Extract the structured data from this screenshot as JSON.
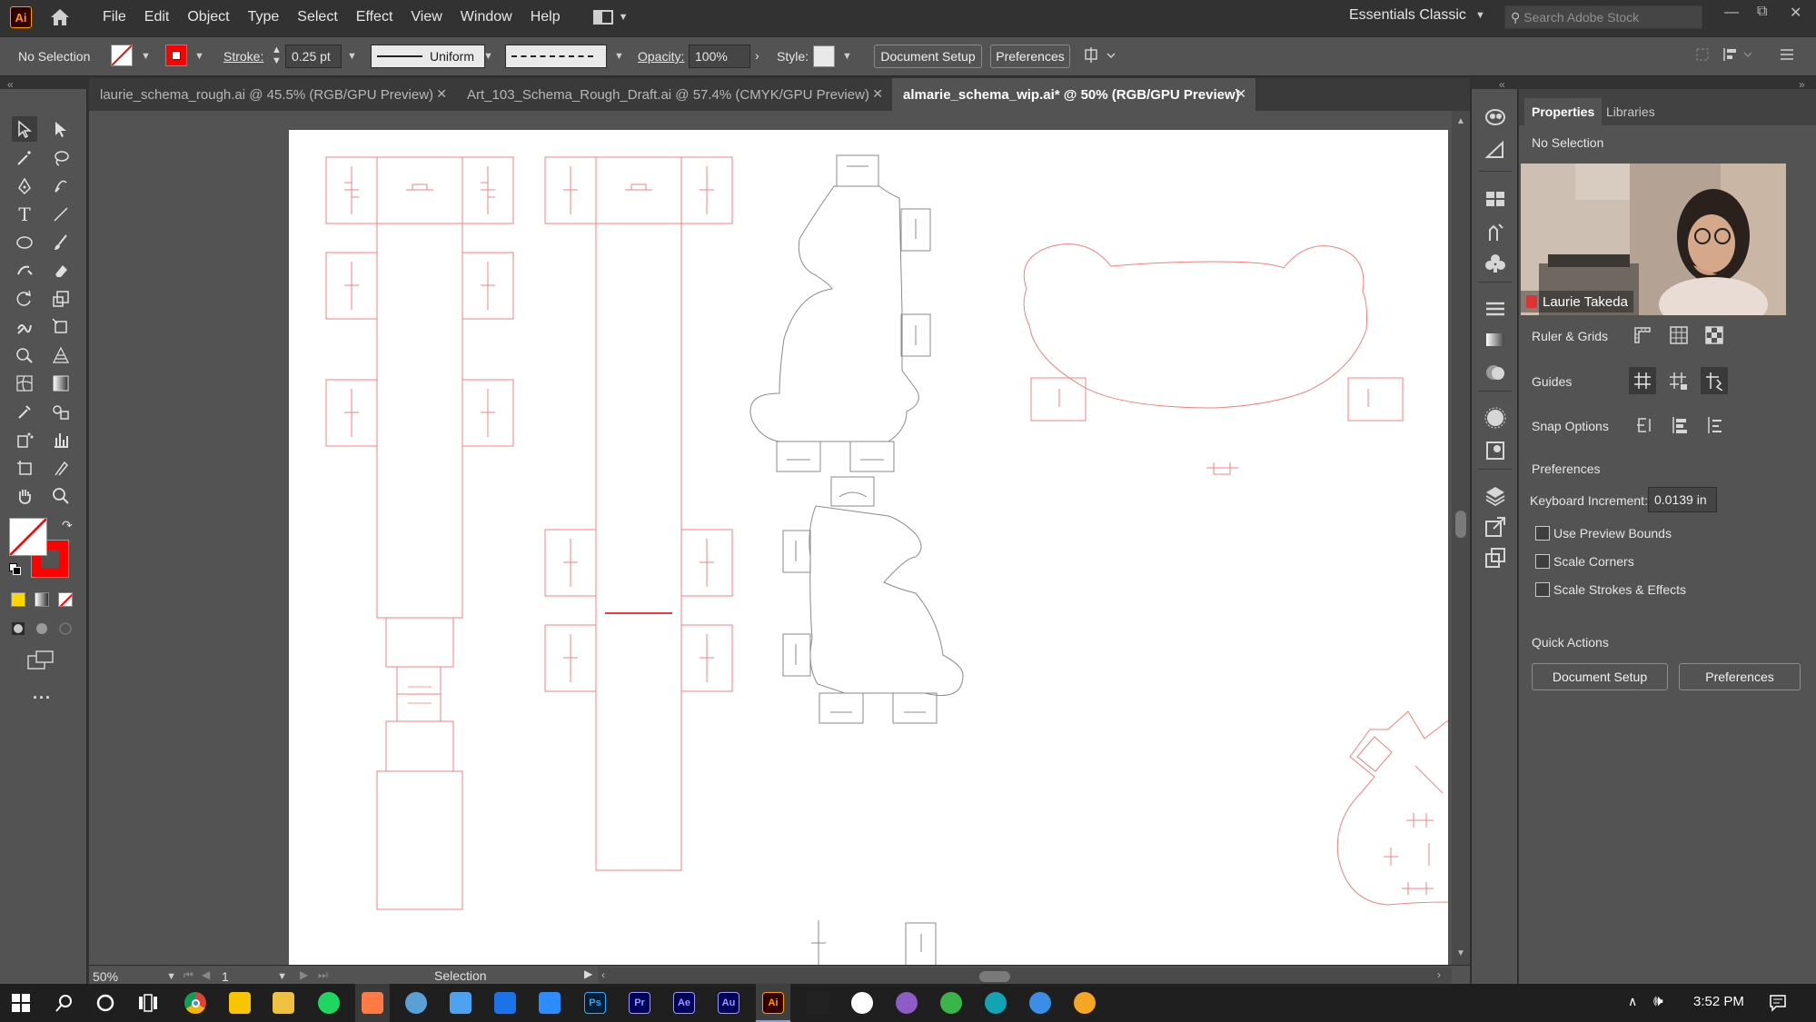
{
  "app": {
    "logo": "Ai"
  },
  "menu": [
    "File",
    "Edit",
    "Object",
    "Type",
    "Select",
    "Effect",
    "View",
    "Window",
    "Help"
  ],
  "workspace": "Essentials Classic",
  "stock_search": {
    "placeholder": "Search Adobe Stock"
  },
  "control": {
    "selection": "No Selection",
    "stroke_label": "Stroke:",
    "stroke_value": "0.25 pt",
    "profile": "Uniform",
    "opacity_label": "Opacity:",
    "opacity_value": "100%",
    "style_label": "Style:",
    "doc_setup": "Document Setup",
    "preferences": "Preferences"
  },
  "tabs": [
    {
      "label": "laurie_schema_rough.ai @ 45.5% (RGB/GPU Preview)",
      "active": false
    },
    {
      "label": "Art_103_Schema_Rough_Draft.ai @ 57.4% (CMYK/GPU Preview)",
      "active": false
    },
    {
      "label": "almarie_schema_wip.ai* @ 50% (RGB/GPU Preview)",
      "active": true
    }
  ],
  "status": {
    "zoom": "50%",
    "page": "1",
    "tool": "Selection"
  },
  "panel": {
    "tab_properties": "Properties",
    "tab_libraries": "Libraries",
    "selection": "No Selection",
    "ruler_grids": "Ruler & Grids",
    "guides": "Guides",
    "snap": "Snap Options",
    "preferences_heading": "Preferences",
    "keyboard_increment_label": "Keyboard Increment:",
    "keyboard_increment_value": "0.0139 in",
    "use_preview_bounds": "Use Preview Bounds",
    "scale_corners": "Scale Corners",
    "scale_strokes": "Scale Strokes & Effects",
    "quick_actions": "Quick Actions",
    "doc_setup": "Document Setup",
    "preferences": "Preferences"
  },
  "video": {
    "name": "Laurie Takeda"
  },
  "taskbar": {
    "time": "3:52 PM"
  },
  "colors": {
    "accent_red": "#ff0000",
    "cut_line": "#f08080",
    "bg_ui": "#535353"
  }
}
